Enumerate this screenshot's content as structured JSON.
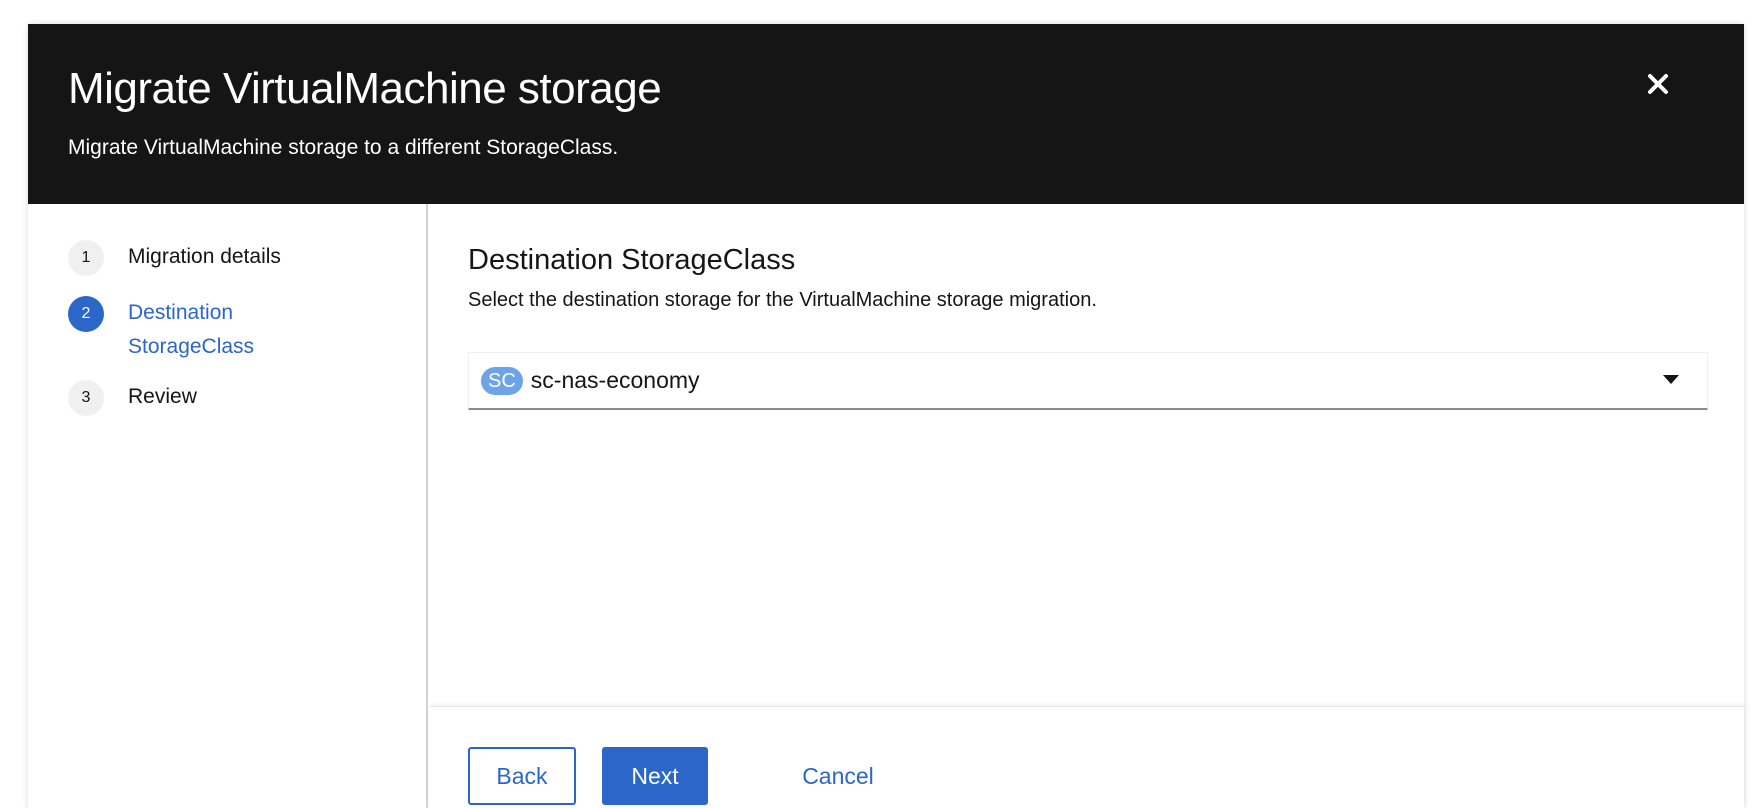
{
  "modal": {
    "title": "Migrate VirtualMachine storage",
    "subtitle": "Migrate VirtualMachine storage to a different StorageClass.",
    "close_icon": "close-icon"
  },
  "wizard": {
    "steps": [
      {
        "number": "1",
        "label": "Migration details",
        "current": false
      },
      {
        "number": "2",
        "label": "Destination StorageClass",
        "current": true
      },
      {
        "number": "3",
        "label": "Review",
        "current": false
      }
    ]
  },
  "main": {
    "heading": "Destination StorageClass",
    "description": "Select the destination storage for the VirtualMachine storage migration.",
    "select": {
      "badge": "SC",
      "value": "sc-nas-economy",
      "caret_icon": "caret-down-icon"
    }
  },
  "footer": {
    "back_label": "Back",
    "next_label": "Next",
    "cancel_label": "Cancel"
  },
  "colors": {
    "header_bg": "#151515",
    "accent": "#2b66c9",
    "badge_bg": "#6da3e8"
  }
}
